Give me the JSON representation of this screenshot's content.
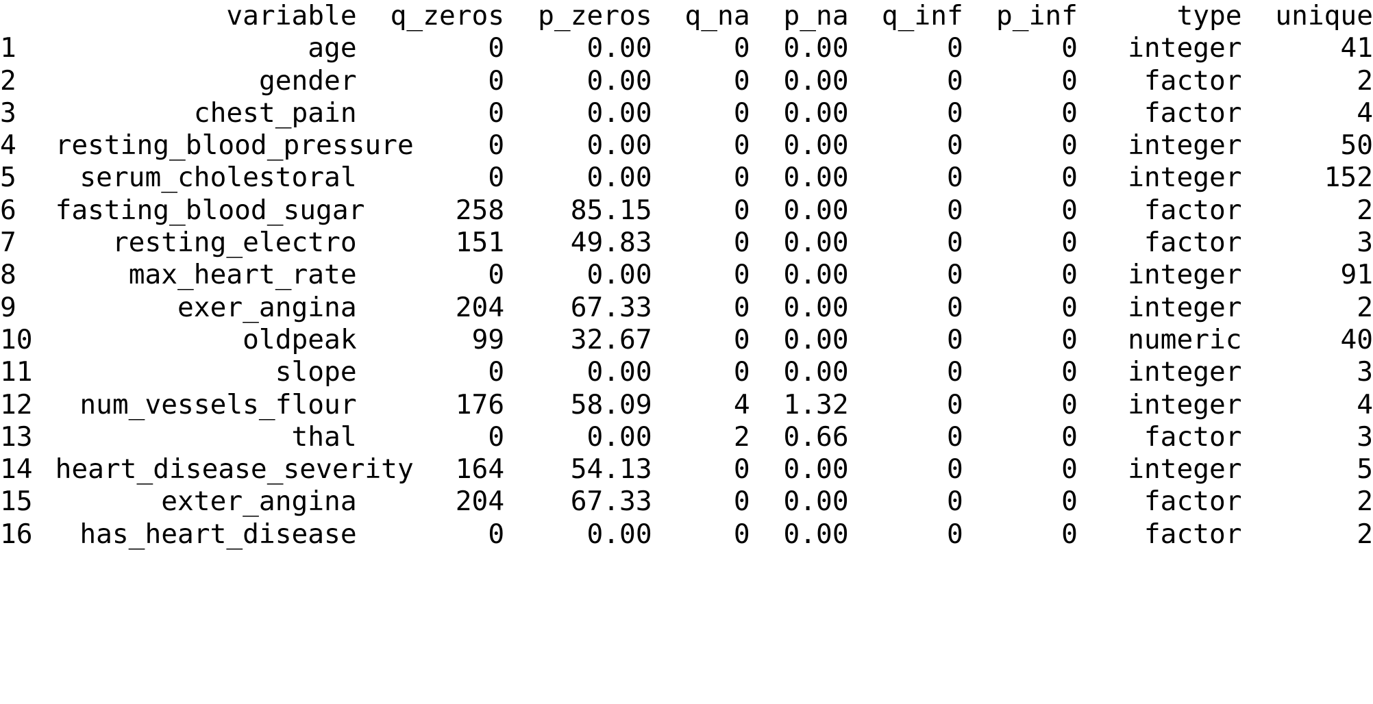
{
  "console": {
    "output_kind": "r-data-frame-print",
    "background_color": "#ffffff",
    "text_color": "#000000"
  },
  "table": {
    "columns": [
      {
        "key": "index",
        "label": "",
        "align": "left"
      },
      {
        "key": "variable",
        "label": "variable",
        "align": "right"
      },
      {
        "key": "q_zeros",
        "label": "q_zeros",
        "align": "right"
      },
      {
        "key": "p_zeros",
        "label": "p_zeros",
        "align": "right"
      },
      {
        "key": "q_na",
        "label": "q_na",
        "align": "right"
      },
      {
        "key": "p_na",
        "label": "p_na",
        "align": "right"
      },
      {
        "key": "q_inf",
        "label": "q_inf",
        "align": "right"
      },
      {
        "key": "p_inf",
        "label": "p_inf",
        "align": "right"
      },
      {
        "key": "type",
        "label": "type",
        "align": "right"
      },
      {
        "key": "unique",
        "label": "unique",
        "align": "right"
      }
    ],
    "header": {
      "index": "",
      "variable": "variable",
      "q_zeros": "q_zeros",
      "p_zeros": "p_zeros",
      "q_na": "q_na",
      "p_na": "p_na",
      "q_inf": "q_inf",
      "p_inf": "p_inf",
      "type": "type",
      "unique": "unique"
    },
    "rows": [
      {
        "index": "1",
        "variable": "age",
        "q_zeros": "0",
        "p_zeros": "0.00",
        "q_na": "0",
        "p_na": "0.00",
        "q_inf": "0",
        "p_inf": "0",
        "type": "integer",
        "unique": "41"
      },
      {
        "index": "2",
        "variable": "gender",
        "q_zeros": "0",
        "p_zeros": "0.00",
        "q_na": "0",
        "p_na": "0.00",
        "q_inf": "0",
        "p_inf": "0",
        "type": "factor",
        "unique": "2"
      },
      {
        "index": "3",
        "variable": "chest_pain",
        "q_zeros": "0",
        "p_zeros": "0.00",
        "q_na": "0",
        "p_na": "0.00",
        "q_inf": "0",
        "p_inf": "0",
        "type": "factor",
        "unique": "4"
      },
      {
        "index": "4",
        "variable": "resting_blood_pressure",
        "q_zeros": "0",
        "p_zeros": "0.00",
        "q_na": "0",
        "p_na": "0.00",
        "q_inf": "0",
        "p_inf": "0",
        "type": "integer",
        "unique": "50"
      },
      {
        "index": "5",
        "variable": "serum_cholestoral",
        "q_zeros": "0",
        "p_zeros": "0.00",
        "q_na": "0",
        "p_na": "0.00",
        "q_inf": "0",
        "p_inf": "0",
        "type": "integer",
        "unique": "152"
      },
      {
        "index": "6",
        "variable": "fasting_blood_sugar",
        "q_zeros": "258",
        "p_zeros": "85.15",
        "q_na": "0",
        "p_na": "0.00",
        "q_inf": "0",
        "p_inf": "0",
        "type": "factor",
        "unique": "2"
      },
      {
        "index": "7",
        "variable": "resting_electro",
        "q_zeros": "151",
        "p_zeros": "49.83",
        "q_na": "0",
        "p_na": "0.00",
        "q_inf": "0",
        "p_inf": "0",
        "type": "factor",
        "unique": "3"
      },
      {
        "index": "8",
        "variable": "max_heart_rate",
        "q_zeros": "0",
        "p_zeros": "0.00",
        "q_na": "0",
        "p_na": "0.00",
        "q_inf": "0",
        "p_inf": "0",
        "type": "integer",
        "unique": "91"
      },
      {
        "index": "9",
        "variable": "exer_angina",
        "q_zeros": "204",
        "p_zeros": "67.33",
        "q_na": "0",
        "p_na": "0.00",
        "q_inf": "0",
        "p_inf": "0",
        "type": "integer",
        "unique": "2"
      },
      {
        "index": "10",
        "variable": "oldpeak",
        "q_zeros": "99",
        "p_zeros": "32.67",
        "q_na": "0",
        "p_na": "0.00",
        "q_inf": "0",
        "p_inf": "0",
        "type": "numeric",
        "unique": "40"
      },
      {
        "index": "11",
        "variable": "slope",
        "q_zeros": "0",
        "p_zeros": "0.00",
        "q_na": "0",
        "p_na": "0.00",
        "q_inf": "0",
        "p_inf": "0",
        "type": "integer",
        "unique": "3"
      },
      {
        "index": "12",
        "variable": "num_vessels_flour",
        "q_zeros": "176",
        "p_zeros": "58.09",
        "q_na": "4",
        "p_na": "1.32",
        "q_inf": "0",
        "p_inf": "0",
        "type": "integer",
        "unique": "4"
      },
      {
        "index": "13",
        "variable": "thal",
        "q_zeros": "0",
        "p_zeros": "0.00",
        "q_na": "2",
        "p_na": "0.66",
        "q_inf": "0",
        "p_inf": "0",
        "type": "factor",
        "unique": "3"
      },
      {
        "index": "14",
        "variable": "heart_disease_severity",
        "q_zeros": "164",
        "p_zeros": "54.13",
        "q_na": "0",
        "p_na": "0.00",
        "q_inf": "0",
        "p_inf": "0",
        "type": "integer",
        "unique": "5"
      },
      {
        "index": "15",
        "variable": "exter_angina",
        "q_zeros": "204",
        "p_zeros": "67.33",
        "q_na": "0",
        "p_na": "0.00",
        "q_inf": "0",
        "p_inf": "0",
        "type": "factor",
        "unique": "2"
      },
      {
        "index": "16",
        "variable": "has_heart_disease",
        "q_zeros": "0",
        "p_zeros": "0.00",
        "q_na": "0",
        "p_na": "0.00",
        "q_inf": "0",
        "p_inf": "0",
        "type": "factor",
        "unique": "2"
      }
    ]
  }
}
